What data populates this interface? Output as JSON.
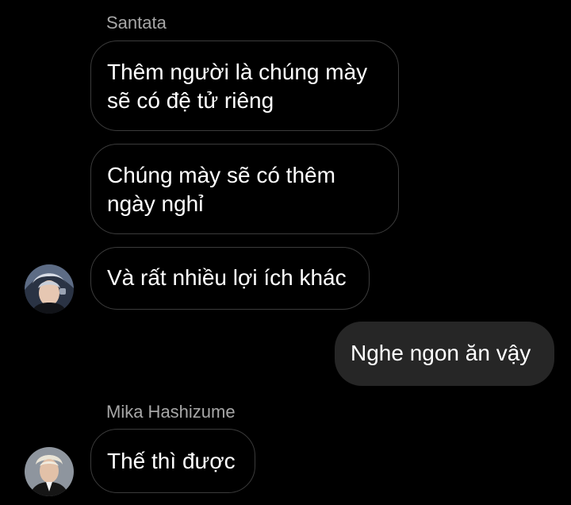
{
  "conversation": {
    "groups": [
      {
        "sender": "Santata",
        "messages": [
          "Thêm người là chúng mày\nsẽ có đệ tử riêng",
          "Chúng mày sẽ có thêm\nngày nghỉ",
          "Và rất nhiều lợi ích khác"
        ],
        "avatar_icon": "user-avatar-photo"
      },
      {
        "sender": "",
        "outgoing": true,
        "messages": [
          "Nghe ngon ăn vậy"
        ]
      },
      {
        "sender": "Mika Hashizume",
        "messages": [
          "Thế thì được"
        ],
        "avatar_icon": "user-avatar-photo"
      }
    ]
  },
  "colors": {
    "background": "#000000",
    "incoming_border": "#3b3b3b",
    "outgoing_bubble": "#262626",
    "sender_name": "#a7a7a7",
    "text": "#ffffff"
  }
}
